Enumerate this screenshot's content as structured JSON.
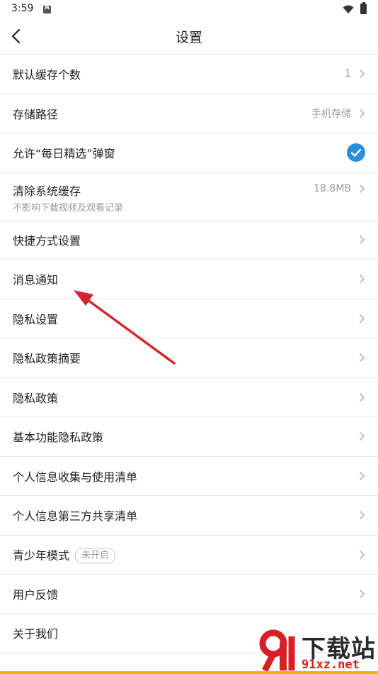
{
  "status_bar": {
    "time": "3:59"
  },
  "header": {
    "title": "设置"
  },
  "settings": {
    "rows": [
      {
        "label": "默认缓存个数",
        "value": "1"
      },
      {
        "label": "存储路径",
        "value": "手机存储"
      },
      {
        "label": "允许“每日精选”弹窗",
        "checked": true
      },
      {
        "label": "清除系统缓存",
        "value": "18.8MB",
        "sublabel": "不影响下载视频及观看记录"
      },
      {
        "label": "快捷方式设置"
      },
      {
        "label": "消息通知"
      },
      {
        "label": "隐私设置"
      },
      {
        "label": "隐私政策摘要"
      },
      {
        "label": "隐私政策"
      },
      {
        "label": "基本功能隐私政策"
      },
      {
        "label": "个人信息收集与使用清单"
      },
      {
        "label": "个人信息第三方共享清单"
      },
      {
        "label": "青少年模式",
        "badge": "未开启"
      },
      {
        "label": "用户反馈"
      },
      {
        "label": "关于我们"
      }
    ]
  },
  "colors": {
    "accent": "#2b8fe0",
    "annotation": "#d6262b",
    "divider": "#e6e6e6"
  },
  "watermark": {
    "logo": "91",
    "brand": "下载站",
    "url": "91xz.net"
  }
}
